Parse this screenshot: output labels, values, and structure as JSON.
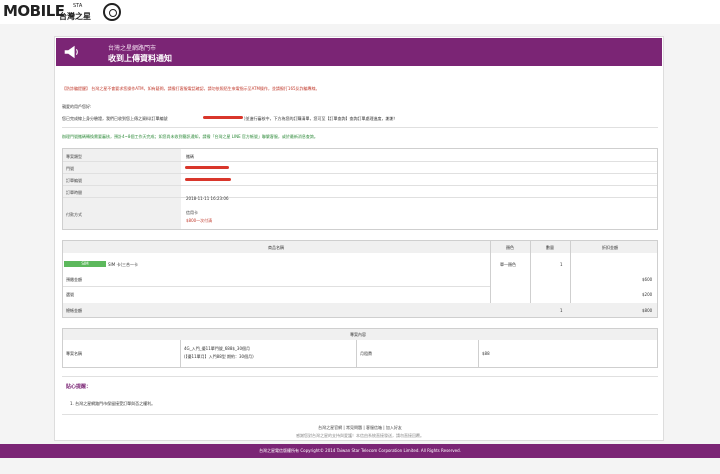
{
  "header": {
    "logo_word": "MOBILE",
    "logo_sup": "STA",
    "logo_cn": "台灣之星"
  },
  "banner": {
    "subtitle": "台灣之星網路門市",
    "title": "收到上傳資料通知"
  },
  "notice": {
    "fraud": "【防詐騙提醒】 台灣之星不會要求您操作ATM，如有疑問，請撥打客服電話確認，請勿依照陌生來電指示至ATM操作，並請撥打165反詐騙專線。",
    "greeting": "親愛的用戶您好:",
    "body_before": "您已完成線上身分驗證，我們已收到您上傳之資料(訂單編號",
    "body_after": ")並進行審核中，下方為您的訂購清單，您可至【訂單查詢】查詢訂單處理進度，謝謝！",
    "order_link": "訂單查詢",
    "green_note": "辦理門號攜碼轉換需要審核，預計4~8個工作天完成；如您尚未收到簡訊通知，請撥「台灣之星 LINE 官方帳號」聯繫客服，或於最新消息查詢。",
    "line_link": "台灣之星 LINE 官方帳號"
  },
  "info": {
    "rows": [
      {
        "label": "專案類型",
        "value": "攜碼"
      },
      {
        "label": "門號",
        "value": ""
      },
      {
        "label": "訂單編號",
        "value": ""
      },
      {
        "label": "訂單時間",
        "value": "2018-11-11    16:23:06"
      },
      {
        "label": "付款方式",
        "value": "信用卡"
      }
    ],
    "payment_note": "$800一次付清"
  },
  "products": {
    "headers": [
      "商品名稱",
      "顏色",
      "數量",
      "折扣金額"
    ],
    "sim_badge": "SIM",
    "item_name": "SIM 卡(三合一卡",
    "item_color": "單一顏色",
    "item_qty": "1",
    "prepay_label": "預繳金額",
    "prepay_value": "$600",
    "deposit_label": "選號",
    "deposit_value": "$200",
    "total_label": "總帳金額",
    "total_qty": "1",
    "total_value": "$800"
  },
  "plan": {
    "header": "專案內容",
    "label": "專案名稱",
    "plan_line1": "4G_入門_優11單門號_688$_30個月",
    "plan_line2": "(【優11單月】入門88型 期約：30個月)",
    "fee_label": "月租費",
    "fee_value": "$88"
  },
  "tip": {
    "title": "貼心提醒：",
    "item1": "1.   台灣之星網路門市保留接受訂單與否之權利。"
  },
  "footer": {
    "link1": "台灣之星官網",
    "link2": "常見問題",
    "link3": "客服信箱",
    "link4": "加入好友",
    "note": "感謝您對台灣之星的支持與愛護！本信由系統直接發送，請勿直接回覆。",
    "copyright": "台灣之星電信版權所有 Copyright© 2014 Taiwan Star Telecom Corporation Limited. All Rights Reserved."
  }
}
